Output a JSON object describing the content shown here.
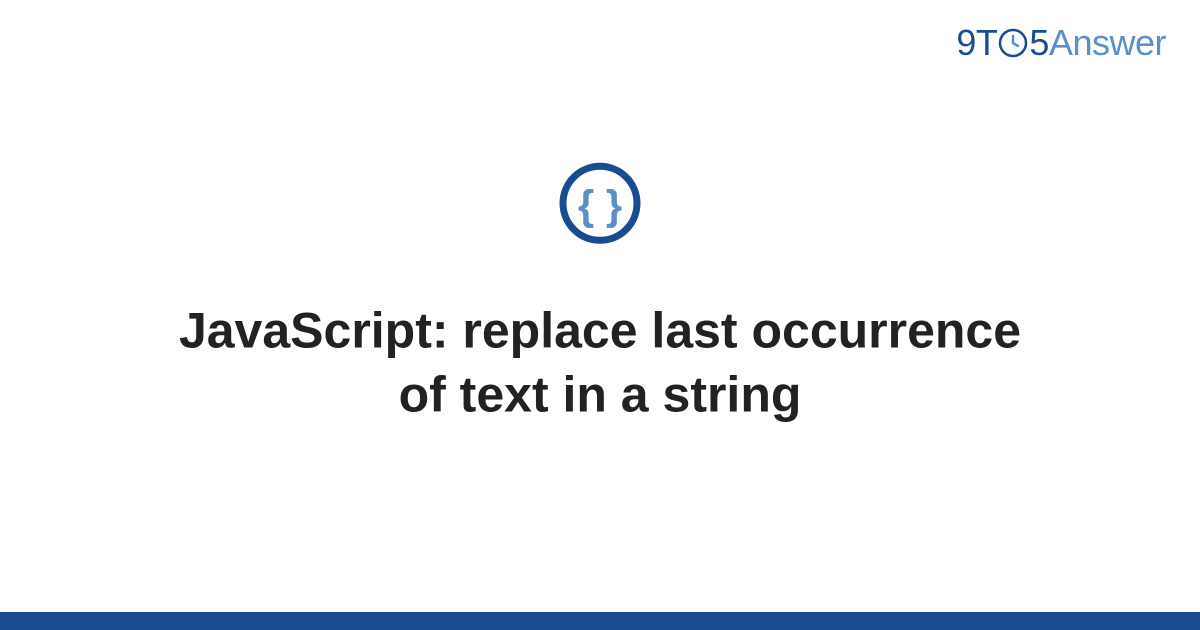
{
  "logo": {
    "part1": "9T",
    "part2": "5",
    "part3": "Answer"
  },
  "title": "JavaScript: replace last occurrence of text in a string",
  "icon_name": "braces-icon",
  "colors": {
    "primary_dark": "#1a4d8f",
    "primary_light": "#5a8fc7",
    "text": "#222222"
  }
}
